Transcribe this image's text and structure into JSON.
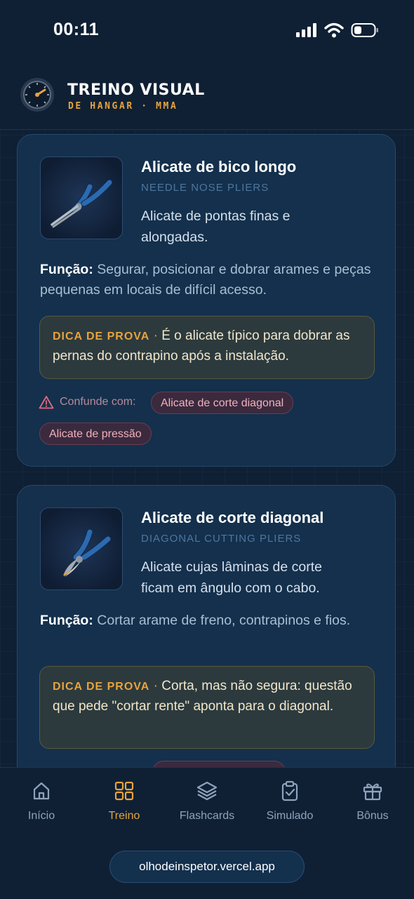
{
  "status_bar": {
    "time": "00:11",
    "icons": [
      "cellular-signal-icon",
      "wifi-icon",
      "battery-icon"
    ]
  },
  "header": {
    "title": "TREINO VISUAL",
    "subtitle": "DE HANGAR · MMA",
    "logo_icon": "gauge-logo-icon"
  },
  "cards": [
    {
      "name": "Alicate de bico longo",
      "english": "NEEDLE NOSE PLIERS",
      "description": "Alicate de pontas finas e alongadas.",
      "function_label": "Função:",
      "function_text": "Segurar, posicionar e dobrar arames e peças pequenas em locais de difícil acesso.",
      "tip_label": "DICA DE PROVA",
      "tip_separator": "·",
      "tip_text": "É o alicate típico para dobrar as pernas do contrapino após a instalação.",
      "confuse_label": "Confunde com:",
      "confuse_with": [
        "Alicate de corte diagonal",
        "Alicate de pressão"
      ]
    },
    {
      "name": "Alicate de corte diagonal",
      "english": "DIAGONAL CUTTING PLIERS",
      "description": "Alicate cujas lâminas de corte ficam em ângulo com o cabo.",
      "function_label": "Função:",
      "function_text": "Cortar arame de freno, contrapinos e fios.",
      "tip_label": "DICA DE PROVA",
      "tip_separator": "·",
      "tip_text": "Corta, mas não segura: questão que pede \"cortar rente\" aponta para o diagonal."
    }
  ],
  "nav": {
    "active": "Treino",
    "items": [
      {
        "label": "Início",
        "icon": "home-icon"
      },
      {
        "label": "Treino",
        "icon": "grid-icon"
      },
      {
        "label": "Flashcards",
        "icon": "layers-icon"
      },
      {
        "label": "Simulado",
        "icon": "clipboard-check-icon"
      },
      {
        "label": "Bônus",
        "icon": "gift-icon"
      }
    ]
  },
  "url": "olhodeinspetor.vercel.app",
  "colors": {
    "background": "#0f2034",
    "card": "#14304c",
    "accent": "#e8a33c",
    "chip": "#3b2a3e",
    "chip_text": "#f0b1bd"
  }
}
